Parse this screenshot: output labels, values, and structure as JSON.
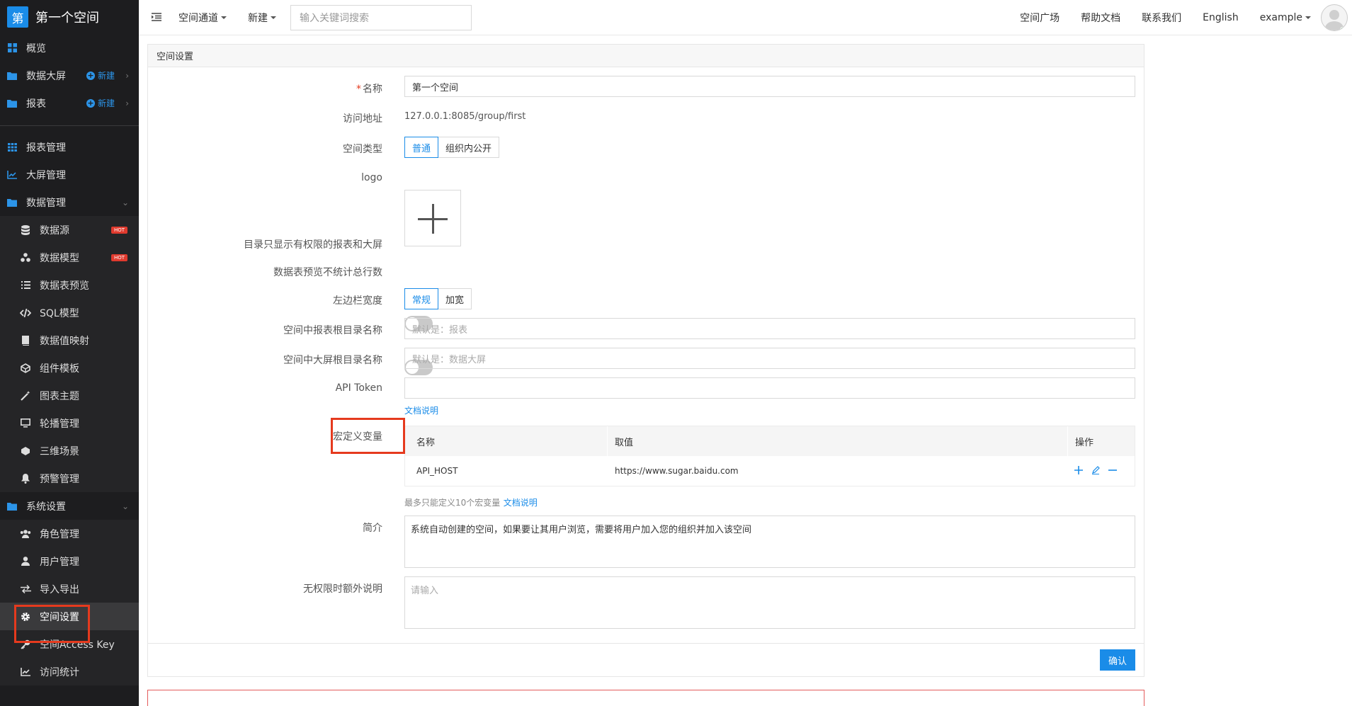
{
  "brand": {
    "logo_char": "第",
    "title": "第一个空间"
  },
  "sidebar": {
    "top": [
      {
        "label": "概览",
        "icon": "grid-icon"
      },
      {
        "label": "数据大屏",
        "icon": "folder-icon",
        "new": "新建"
      },
      {
        "label": "报表",
        "icon": "folder-icon",
        "new": "新建"
      }
    ],
    "manage": [
      {
        "label": "报表管理",
        "icon": "table-icon"
      },
      {
        "label": "大屏管理",
        "icon": "chart-line-icon"
      },
      {
        "label": "数据管理",
        "icon": "folder-icon"
      }
    ],
    "data_sub": [
      {
        "label": "数据源",
        "icon": "database-icon",
        "badge": "HOT"
      },
      {
        "label": "数据模型",
        "icon": "model-icon",
        "badge": "HOT"
      },
      {
        "label": "数据表预览",
        "icon": "list-icon"
      },
      {
        "label": "SQL模型",
        "icon": "code-icon"
      },
      {
        "label": "数据值映射",
        "icon": "book-icon"
      },
      {
        "label": "组件模板",
        "icon": "cube-icon"
      },
      {
        "label": "图表主题",
        "icon": "magic-icon"
      },
      {
        "label": "轮播管理",
        "icon": "monitor-icon"
      },
      {
        "label": "三维场景",
        "icon": "box-icon"
      },
      {
        "label": "预警管理",
        "icon": "bell-icon"
      }
    ],
    "system": {
      "label": "系统设置",
      "icon": "folder-icon"
    },
    "system_sub": [
      {
        "label": "角色管理",
        "icon": "users-icon"
      },
      {
        "label": "用户管理",
        "icon": "user-icon"
      },
      {
        "label": "导入导出",
        "icon": "exchange-icon"
      },
      {
        "label": "空间设置",
        "icon": "gear-icon"
      },
      {
        "label": "空间Access Key",
        "icon": "key-icon"
      },
      {
        "label": "访问统计",
        "icon": "chart-line-icon"
      }
    ]
  },
  "topbar": {
    "space_channel": "空间通道",
    "new": "新建",
    "search_placeholder": "输入关键词搜索",
    "links": [
      "空间广场",
      "帮助文档",
      "联系我们",
      "English"
    ],
    "user": "example"
  },
  "panel": {
    "title": "空间设置",
    "name_label": "名称",
    "name_value": "第一个空间",
    "address_label": "访问地址",
    "address_value": "127.0.0.1:8085/group/first",
    "type_label": "空间类型",
    "type_options": [
      "普通",
      "组织内公开"
    ],
    "logo_label": "logo",
    "perm_label": "目录只显示有权限的报表和大屏",
    "count_label": "数据表预览不统计总行数",
    "width_label": "左边栏宽度",
    "width_options": [
      "常规",
      "加宽"
    ],
    "report_root_label": "空间中报表根目录名称",
    "report_root_placeholder": "默认是：报表",
    "screen_root_label": "空间中大屏根目录名称",
    "screen_root_placeholder": "默认是：数据大屏",
    "token_label": "API Token",
    "token_doc": "文档说明",
    "macro_label": "宏定义变量",
    "macro_table": {
      "headers": [
        "名称",
        "取值",
        "操作"
      ],
      "rows": [
        {
          "name": "API_HOST",
          "value": "https://www.sugar.baidu.com"
        }
      ]
    },
    "macro_hint": "最多只能定义10个宏变量",
    "macro_doc": "文档说明",
    "intro_label": "简介",
    "intro_value": "系统自动创建的空间，如果要让其用户浏览，需要将用户加入您的组织并加入该空间",
    "extra_label": "无权限时额外说明",
    "extra_placeholder": "请输入",
    "confirm": "确认"
  }
}
